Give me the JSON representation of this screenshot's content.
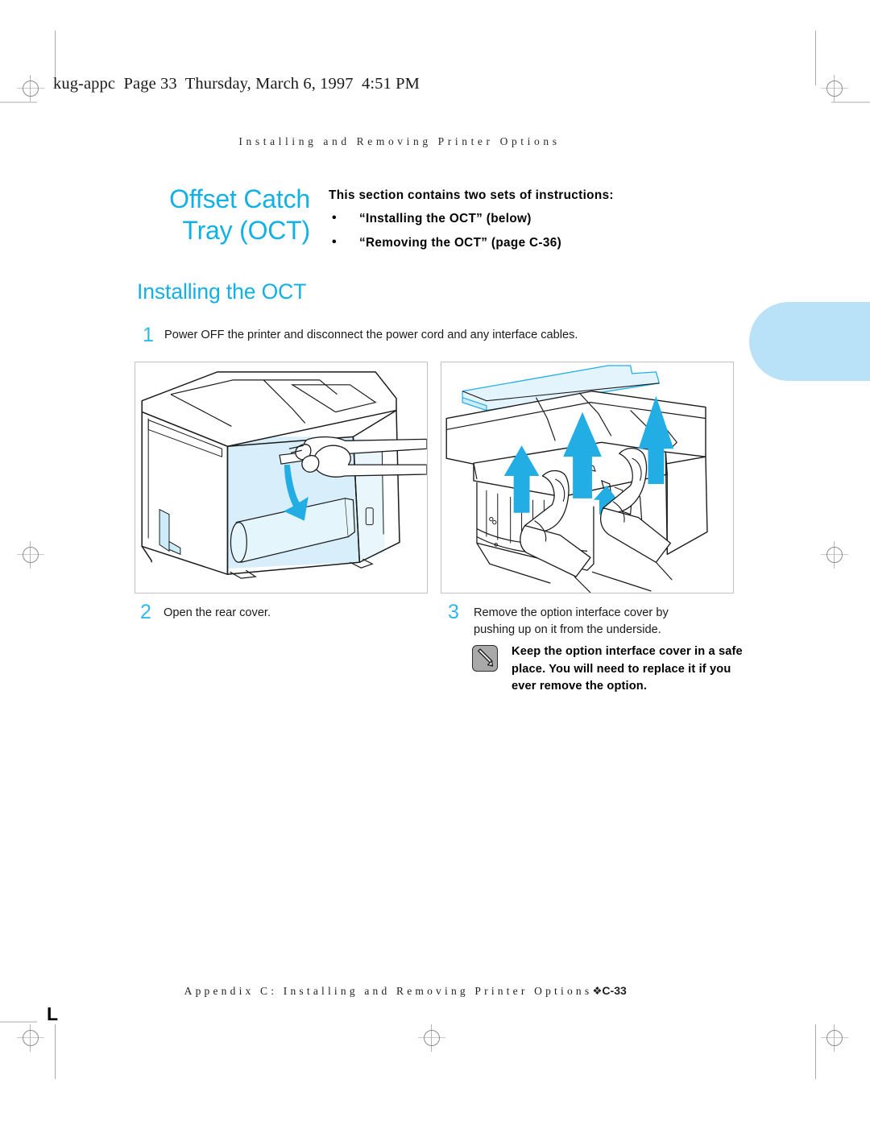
{
  "page": {
    "file_header": "kug-appc  Page 33  Thursday, March 6, 1997  4:51 PM",
    "running_head": "Installing and Removing Printer Options",
    "accent_color": "#13b0e6",
    "tab_color": "#b9e2f8"
  },
  "chapter": {
    "title_line1": "Offset Catch",
    "title_line2": "Tray (OCT)"
  },
  "intro": {
    "lead": "This section contains two sets of instructions:",
    "bullet_char": "•",
    "bullets": [
      "“Installing the OCT” (below)",
      "“Removing the OCT” (page C-36)"
    ]
  },
  "section": {
    "heading": "Installing the OCT"
  },
  "steps": [
    {
      "number": "1",
      "text": "Power OFF the printer and disconnect the power cord and any interface cables."
    },
    {
      "number": "2",
      "text": "Open the rear cover."
    },
    {
      "number": "3",
      "text": "Remove the option interface cover by pushing up on it from the underside."
    }
  ],
  "note": {
    "icon": "pencil-icon",
    "text": "Keep the option interface cover in a safe place. You will need to replace it if you ever remove the option."
  },
  "illustrations": [
    {
      "name": "printer-rear-cover-illustration",
      "caption_step": "2",
      "description": "Line drawing of printer with highlighted rear cover, hand pulling latch, curved down arrow"
    },
    {
      "name": "option-interface-cover-illustration",
      "caption_step": "3",
      "description": "Line drawing of two hands pushing the option interface cover up, three large up arrows"
    }
  ],
  "footer": {
    "text": "Appendix C: Installing and Removing Printer Options",
    "separator": "❖",
    "page_number": "C-33"
  }
}
